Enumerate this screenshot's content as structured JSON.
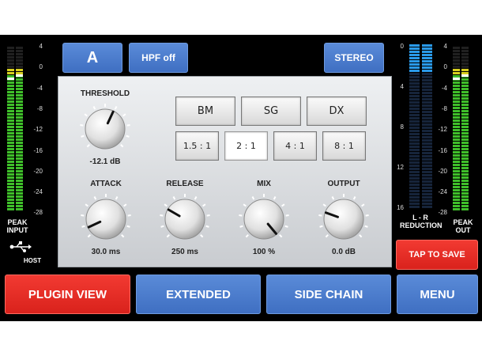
{
  "top": {
    "preset_label": "A",
    "hpf_label": "HPF off",
    "stereo_label": "STEREO"
  },
  "panel": {
    "threshold": {
      "label": "THRESHOLD",
      "value": "-12.1 dB"
    },
    "mode_buttons": [
      "BM",
      "SG",
      "DX"
    ],
    "ratio_buttons": [
      "1.5 : 1",
      "2 : 1",
      "4 : 1",
      "8 : 1"
    ],
    "selected_ratio": "2 : 1",
    "knobs": [
      {
        "label": "ATTACK",
        "value": "30.0 ms"
      },
      {
        "label": "RELEASE",
        "value": "250 ms"
      },
      {
        "label": "MIX",
        "value": "100 %"
      },
      {
        "label": "OUTPUT",
        "value": "0.0 dB"
      }
    ]
  },
  "meters": {
    "left_scale": [
      "4",
      "0",
      "-4",
      "-8",
      "-12",
      "-16",
      "-20",
      "-24",
      "-28"
    ],
    "peak_input_label_1": "PEAK",
    "peak_input_label_2": "INPUT",
    "host_label": "HOST",
    "reduction_label_1": "L - R",
    "reduction_label_2": "REDUCTION",
    "peak_out_label_1": "PEAK",
    "peak_out_label_2": "OUT",
    "right_scale": [
      "4",
      "0",
      "-4",
      "-8",
      "-12",
      "-16",
      "-20",
      "-24",
      "-28"
    ],
    "reduction_scale": [
      "0",
      "4",
      "8",
      "12",
      "16"
    ]
  },
  "tap_to_save": "TAP TO SAVE",
  "bottom_bar": {
    "plugin_view": "PLUGIN VIEW",
    "extended": "EXTENDED",
    "side_chain": "SIDE CHAIN",
    "menu": "MENU"
  },
  "colors": {
    "blue_button": "#4a7cd0",
    "red_button": "#e82a22",
    "meter_green": "#3fbf2a",
    "meter_yellow": "#d8d020",
    "reduction_blue": "#2a9ae8"
  }
}
